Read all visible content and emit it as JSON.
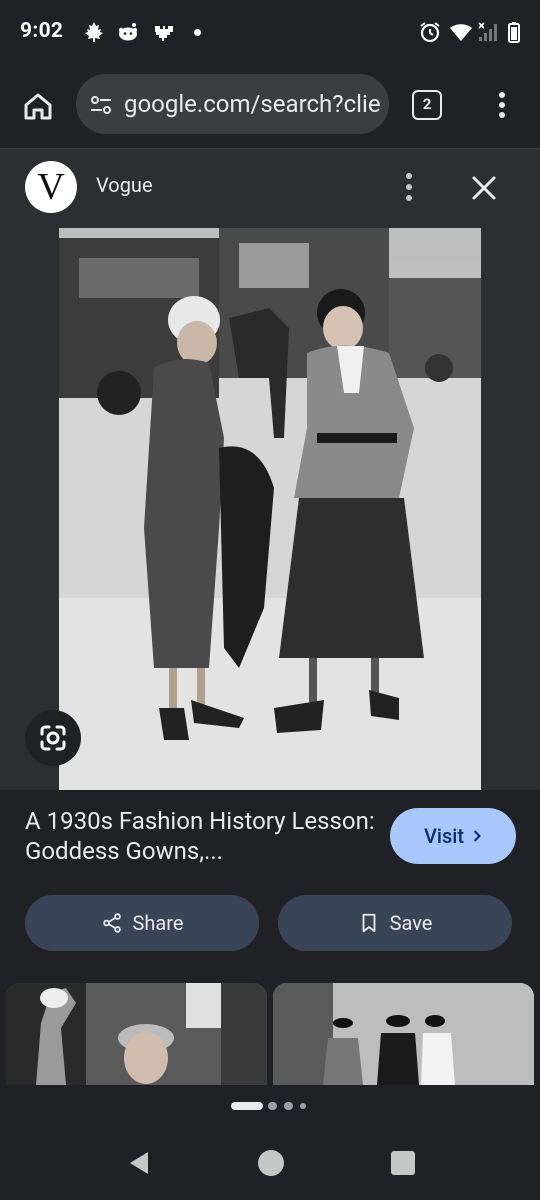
{
  "status_bar": {
    "time": "9:02",
    "left_icons": [
      "maple-leaf-icon",
      "reddit-icon",
      "pixel-heart-icon",
      "dot-icon"
    ],
    "right_icons": [
      "alarm-icon",
      "wifi-icon",
      "signal-icon",
      "battery-icon"
    ]
  },
  "browser": {
    "url": "google.com/search?clie",
    "tab_count": "2"
  },
  "source": {
    "logo_letter": "V",
    "name": "Vogue"
  },
  "image": {
    "description_icon": "photo-two-women-1930s-fashion"
  },
  "result": {
    "title": "A 1930s Fashion History Lesson: Goddess Gowns,...",
    "visit_label": "Visit"
  },
  "actions": {
    "share_label": "Share",
    "save_label": "Save"
  },
  "related": {
    "thumbnails": [
      "waving-woman-photo",
      "street-fashion-photo"
    ]
  },
  "carousel": {
    "active_index": 0,
    "count": 4
  },
  "colors": {
    "background": "#202124",
    "header": "#2d2e31",
    "visit_button": "#a8c7fa",
    "action_button": "#394457"
  }
}
